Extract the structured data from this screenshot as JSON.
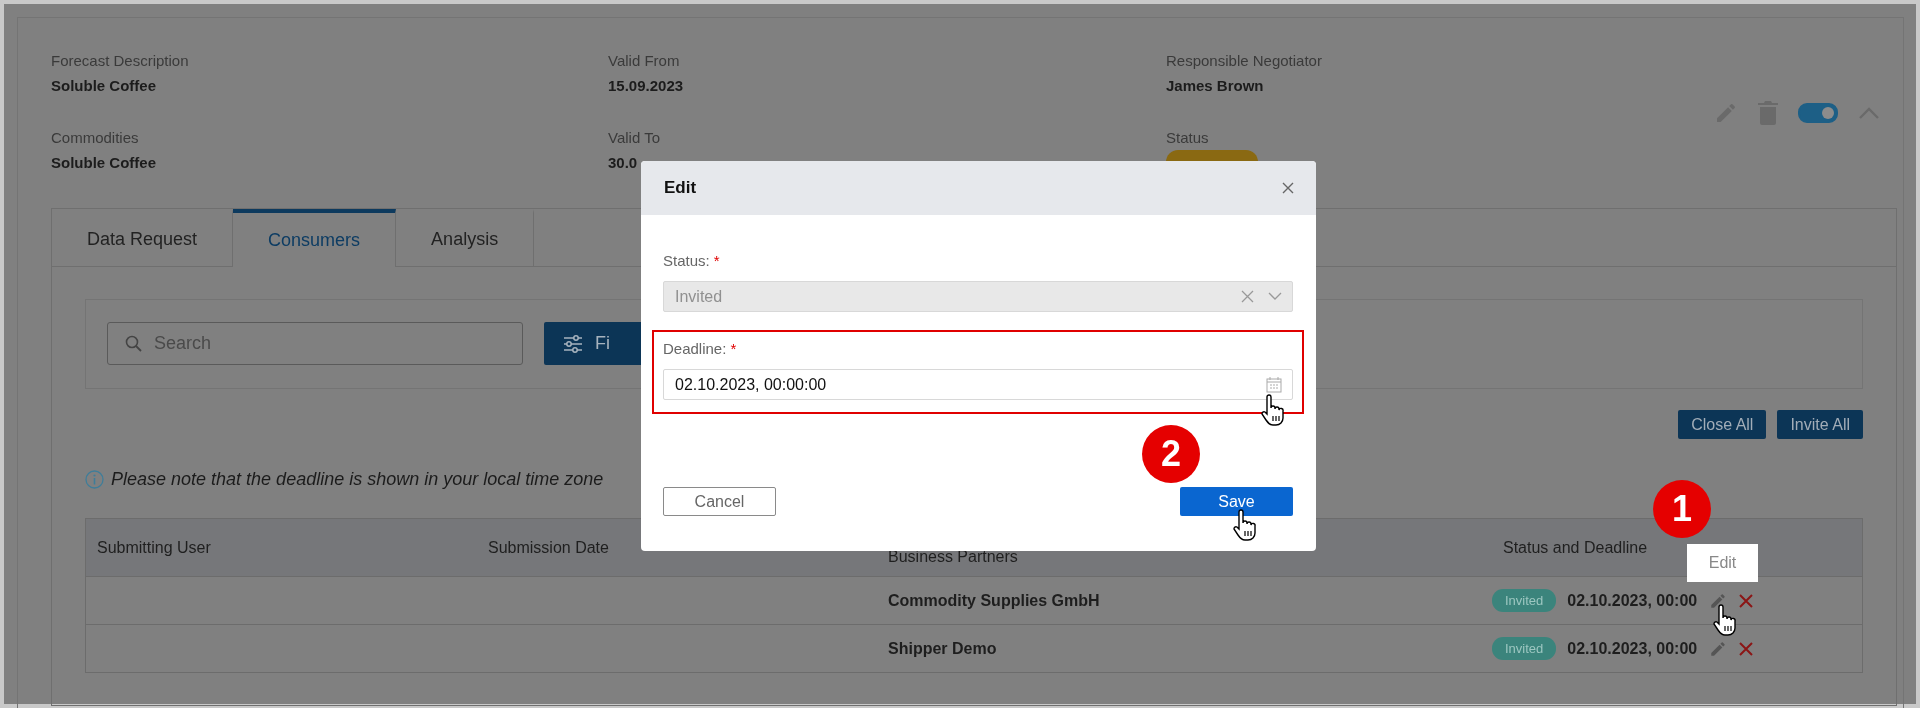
{
  "details": [
    {
      "label": "Forecast Description",
      "kind": "text",
      "value": "Soluble Coffee"
    },
    {
      "label": "Valid From",
      "kind": "text",
      "value": "15.09.2023"
    },
    {
      "label": "Responsible Negotiator",
      "kind": "text",
      "value": "James Brown"
    },
    {
      "label": "Commodities",
      "kind": "text",
      "value": "Soluble Coffee"
    },
    {
      "label": "Valid To",
      "kind": "text",
      "value": "30.0"
    },
    {
      "label": "Status",
      "kind": "badge"
    }
  ],
  "header_actions": {
    "toggle": {
      "on": true
    }
  },
  "tabs": [
    {
      "label": "Data Request",
      "selected": false
    },
    {
      "label": "Consumers",
      "selected": true
    },
    {
      "label": "Analysis",
      "selected": false
    }
  ],
  "filter": {
    "search": {
      "placeholder": "Search"
    },
    "filter_button": "Fi"
  },
  "actions": [
    "Close All",
    "Invite All"
  ],
  "note": "Please note that the deadline is shown in your local time zone",
  "table": {
    "columns": [
      "Submitting User",
      "Submission Date",
      "Business Partners",
      "Status and Deadline"
    ],
    "rows": [
      {
        "business_partner": "Commodity Supplies GmbH",
        "status": "Invited",
        "deadline": "02.10.2023, 00:00"
      },
      {
        "business_partner": "Shipper Demo",
        "status": "Invited",
        "deadline": "02.10.2023, 00:00"
      }
    ]
  },
  "tooltip": "Edit",
  "modal": {
    "title": "Edit",
    "fields": [
      {
        "kind": "select",
        "label": "Status:",
        "required_mark": "*",
        "value": "Invited",
        "disabled": true,
        "highlighted": false
      },
      {
        "kind": "date",
        "label": "Deadline:",
        "required_mark": "*",
        "value": "02.10.2023, 00:00:00",
        "disabled": false,
        "highlighted": true
      }
    ],
    "buttons": [
      {
        "kind": "secondary",
        "label": "Cancel"
      },
      {
        "kind": "primary",
        "label": "Save"
      }
    ]
  },
  "steps": [
    "1",
    "2"
  ]
}
